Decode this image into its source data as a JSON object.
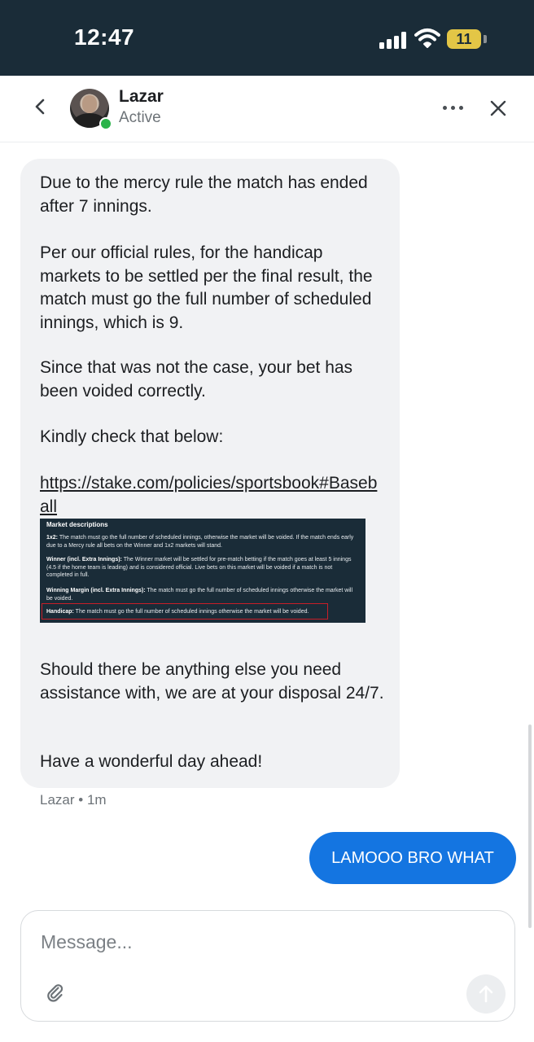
{
  "status_bar": {
    "time": "12:47",
    "battery": "11",
    "icons": [
      "signal-icon",
      "wifi-icon",
      "battery-icon"
    ]
  },
  "header": {
    "agent_name": "Lazar",
    "agent_status": "Active",
    "icons": [
      "chevron-left-icon",
      "more-icon",
      "close-icon"
    ]
  },
  "agent_message": {
    "paragraphs": [
      "Due to the mercy rule the match has ended after 7 innings.",
      "Per our official rules, for the handicap markets to be settled per the final result, the match must go the full number of scheduled innings, which is 9.",
      "Since that was not the case, your bet has been voided correctly.",
      "Kindly check that below:",
      "https://stake.com/policies/sportsbook#Baseball",
      "Should there be anything else you need assistance with, we are at your disposal 24/7.",
      "Have a wonderful day ahead!"
    ],
    "screenshot": {
      "title": "Market descriptions",
      "rows": [
        {
          "label": "1x2:",
          "text": "The match must go the full number of scheduled innings, otherwise the market will be voided. If the match ends early due to a Mercy rule all bets on the Winner and 1x2 markets will stand."
        },
        {
          "label": "Winner (incl. Extra Innings):",
          "text": "The Winner market will be settled for pre-match betting if the match goes at least 5 innings (4.5 if the home team is leading) and is considered official. Live bets on this market will be voided if a match is not completed in full."
        },
        {
          "label": "Winning Margin (incl. Extra Innings):",
          "text": "The match must go the full number of scheduled innings otherwise the market will be voided."
        },
        {
          "label": "Handicap:",
          "text": "The match must go the full number of scheduled innings otherwise the market will be voided."
        }
      ]
    },
    "sender": "Lazar",
    "time_ago": "1m"
  },
  "user_message": {
    "text": "LAMOOO BRO WHAT"
  },
  "composer": {
    "placeholder": "Message...",
    "value": "",
    "icons": [
      "paperclip-icon",
      "send-arrow-icon"
    ]
  },
  "colors": {
    "status_bar_bg": "#1a2c38",
    "agent_bubble_bg": "#f1f2f4",
    "user_bubble_bg": "#1475e1",
    "online_dot": "#2bb34a",
    "battery": "#e3c646",
    "highlight_border": "#c81e28"
  }
}
